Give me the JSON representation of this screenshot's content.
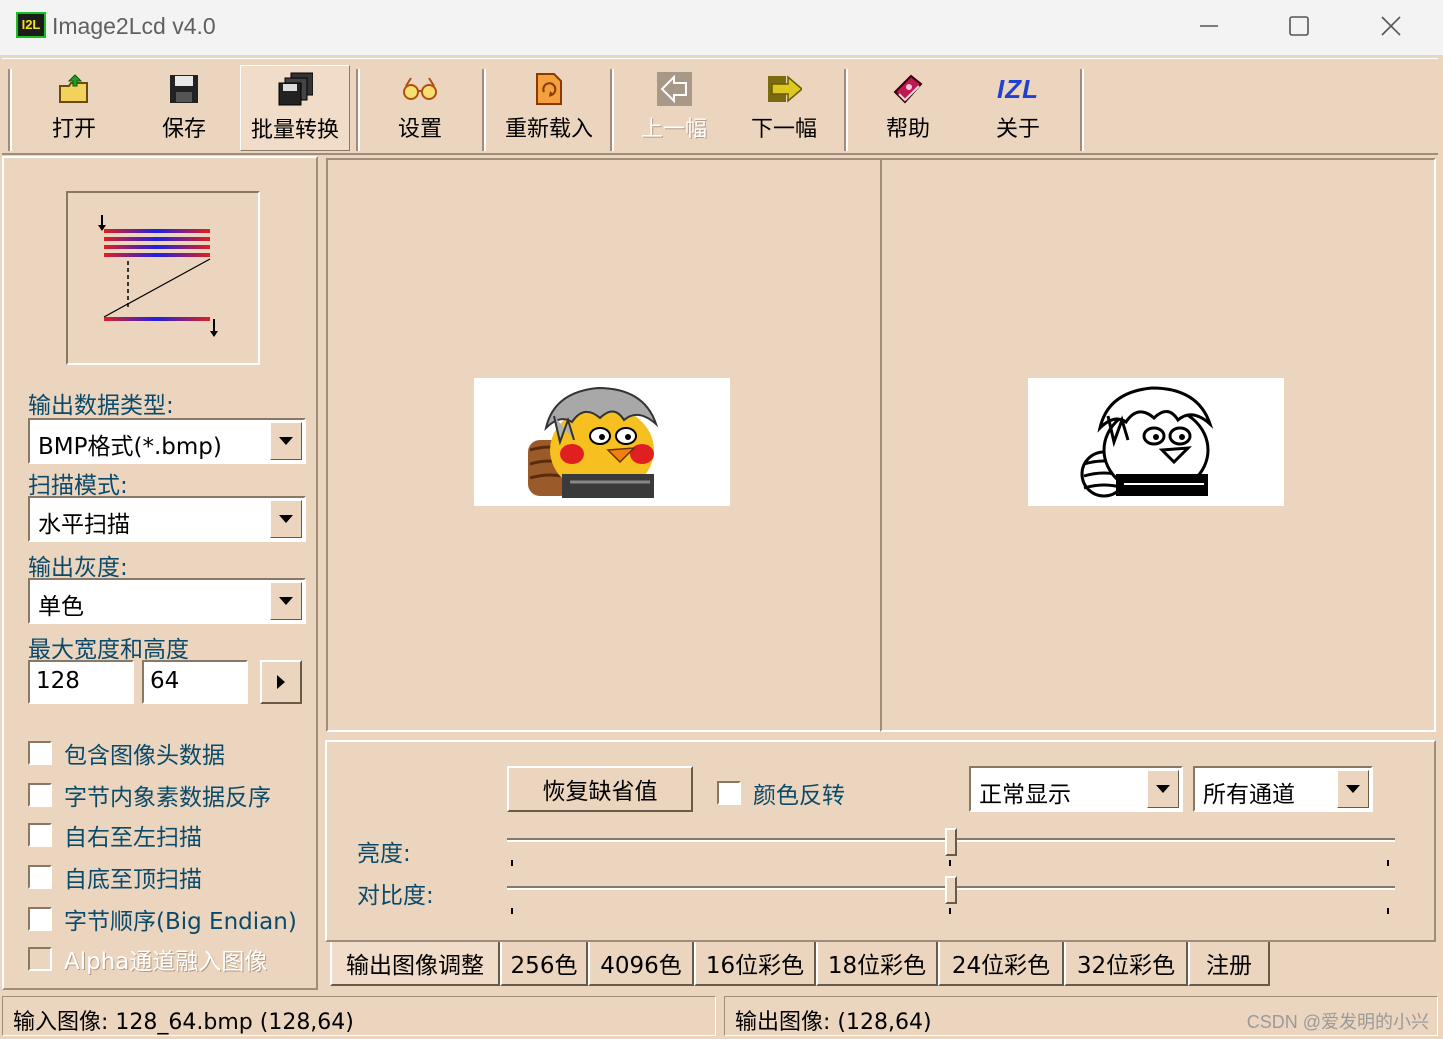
{
  "window": {
    "app_icon_text": "I2L",
    "title": "Image2Lcd v4.0"
  },
  "toolbar": {
    "open": "打开",
    "save": "保存",
    "batch": "批量转换",
    "settings": "设置",
    "reload": "重新载入",
    "prev": "上一幅",
    "next": "下一幅",
    "help": "帮助",
    "about": "关于",
    "about_icon_text": "IZL"
  },
  "left": {
    "output_type_label": "输出数据类型:",
    "output_type_value": "BMP格式(*.bmp)",
    "scan_mode_label": "扫描模式:",
    "scan_mode_value": "水平扫描",
    "gray_label": "输出灰度:",
    "gray_value": "单色",
    "size_label": "最大宽度和高度",
    "width": "128",
    "height": "64",
    "checkboxes": [
      {
        "label": "包含图像头数据",
        "checked": false
      },
      {
        "label": "字节内象素数据反序",
        "checked": false
      },
      {
        "label": "自右至左扫描",
        "checked": false
      },
      {
        "label": "自底至顶扫描",
        "checked": false
      },
      {
        "label": "字节顺序(Big Endian)",
        "checked": false
      },
      {
        "label": "Alpha通道融入图像",
        "checked": false,
        "disabled": true
      }
    ]
  },
  "adjust": {
    "restore_button": "恢复缺省值",
    "invert_label": "颜色反转",
    "display_mode": "正常显示",
    "channel": "所有通道",
    "brightness_label": "亮度:",
    "contrast_label": "对比度:",
    "brightness_level": 0.5,
    "contrast_level": 0.5
  },
  "tabs": [
    "输出图像调整",
    "256色",
    "4096色",
    "16位彩色",
    "18位彩色",
    "24位彩色",
    "32位彩色",
    "注册"
  ],
  "status": {
    "input": "输入图像: 128_64.bmp (128,64)",
    "output": "输出图像: (128,64)",
    "watermark": "CSDN @爱发明的小兴"
  },
  "colors": {
    "panel": "#ecd5be",
    "label_text": "#0a4a6a"
  }
}
